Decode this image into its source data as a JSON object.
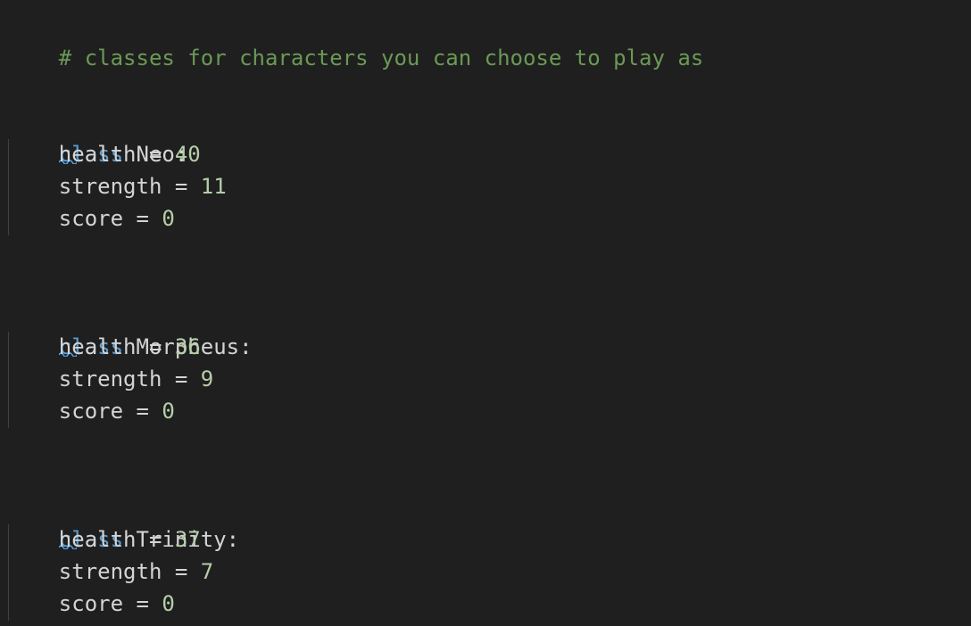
{
  "comment": "# classes for characters you can choose to play as",
  "keyword": "class",
  "attributes": {
    "health": "health",
    "strength": "strength",
    "score": "score"
  },
  "operator": "=",
  "classes": [
    {
      "name": "Neo:",
      "health": "40",
      "strength": "11",
      "score": "0"
    },
    {
      "name": "Morpheus:",
      "health": "36",
      "strength": "9",
      "score": "0"
    },
    {
      "name": "Trinity:",
      "health": "37",
      "strength": "7",
      "score": "0"
    }
  ],
  "colors": {
    "background": "#1f1f1f",
    "comment": "#6a9955",
    "keyword": "#569cd6",
    "identifier": "#d4d4d4",
    "number": "#b5cea8",
    "squiggle": "#4fa0e8"
  }
}
